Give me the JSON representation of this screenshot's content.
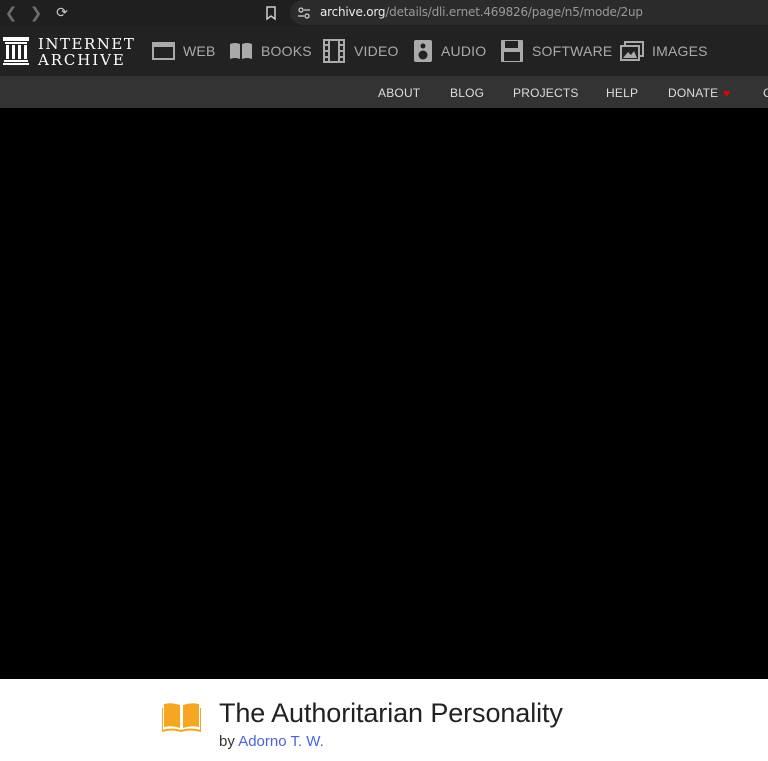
{
  "browser": {
    "url_host": "archive.org",
    "url_path": "/details/dli.ernet.469826/page/n5/mode/2up"
  },
  "header": {
    "logo_line1": "INTERNET",
    "logo_line2": "ARCHIVE",
    "media": [
      {
        "label": "WEB",
        "icon": "web-icon"
      },
      {
        "label": "BOOKS",
        "icon": "books-icon"
      },
      {
        "label": "VIDEO",
        "icon": "video-icon"
      },
      {
        "label": "AUDIO",
        "icon": "audio-icon"
      },
      {
        "label": "SOFTWARE",
        "icon": "software-icon"
      },
      {
        "label": "IMAGES",
        "icon": "images-icon"
      }
    ]
  },
  "subnav": {
    "items": [
      "ABOUT",
      "BLOG",
      "PROJECTS",
      "HELP",
      "DONATE"
    ],
    "cut_off": "C"
  },
  "item": {
    "title": "The Authoritarian Personality",
    "by_prefix": "by",
    "author": "Adorno T. W."
  },
  "colors": {
    "header_bg": "#222222",
    "subnav_bg": "#333333",
    "link": "#4b64de",
    "book_icon": "#f5a623",
    "heart": "#e00000"
  }
}
